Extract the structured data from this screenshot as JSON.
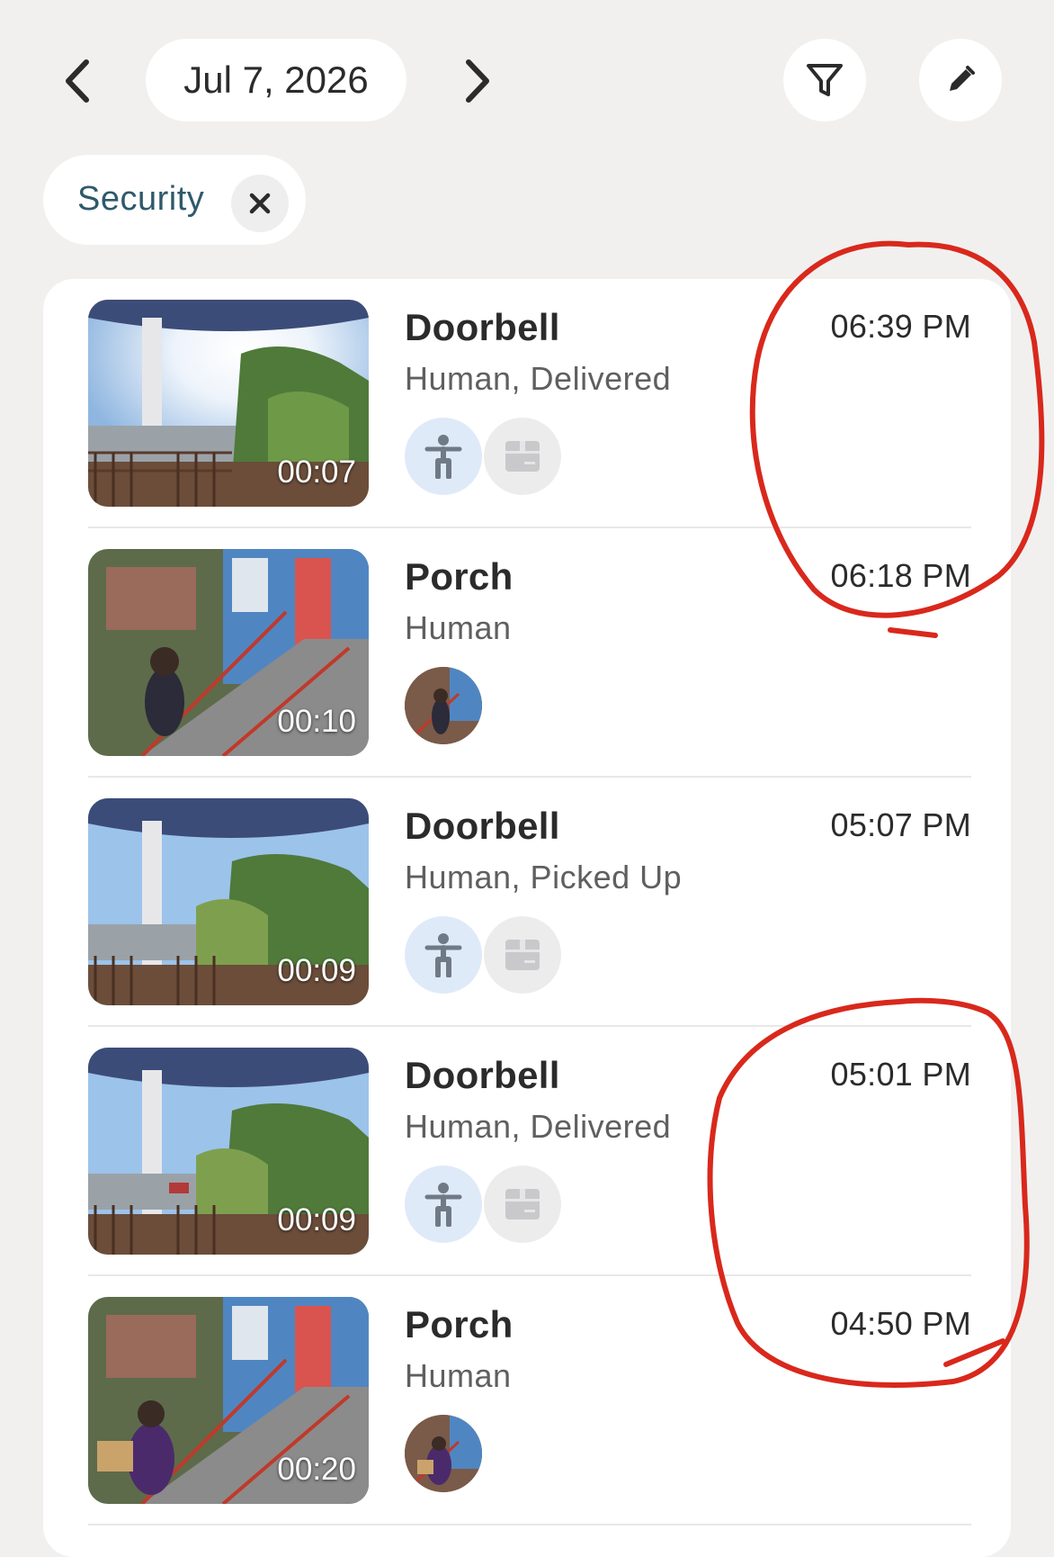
{
  "header": {
    "date": "Jul 7, 2026",
    "prev_icon": "chevron-left-icon",
    "next_icon": "chevron-right-icon",
    "filter_icon": "filter-icon",
    "edit_icon": "pencil-icon"
  },
  "filter_chip": {
    "label": "Security",
    "close_icon": "close-icon"
  },
  "events": [
    {
      "title": "Doorbell",
      "subtitle": "Human, Delivered",
      "time": "06:39 PM",
      "duration": "00:07",
      "camera": "doorbell",
      "tags": [
        "human-icon",
        "package-icon"
      ]
    },
    {
      "title": "Porch",
      "subtitle": "Human",
      "time": "06:18 PM",
      "duration": "00:10",
      "camera": "porch",
      "tags": [
        "face-thumbnail"
      ]
    },
    {
      "title": "Doorbell",
      "subtitle": "Human, Picked Up",
      "time": "05:07 PM",
      "duration": "00:09",
      "camera": "doorbell",
      "tags": [
        "human-icon",
        "package-icon"
      ]
    },
    {
      "title": "Doorbell",
      "subtitle": "Human, Delivered",
      "time": "05:01 PM",
      "duration": "00:09",
      "camera": "doorbell",
      "tags": [
        "human-icon",
        "package-icon"
      ]
    },
    {
      "title": "Porch",
      "subtitle": "Human",
      "time": "04:50 PM",
      "duration": "00:20",
      "camera": "porch",
      "tags": [
        "face-thumbnail"
      ]
    }
  ],
  "colors": {
    "background": "#f1f0ef",
    "card": "#ffffff",
    "chip_text": "#2e5a6b",
    "human_tag": "#dfeaf9",
    "package_tag": "#ececed",
    "annotation": "#d9281c"
  }
}
